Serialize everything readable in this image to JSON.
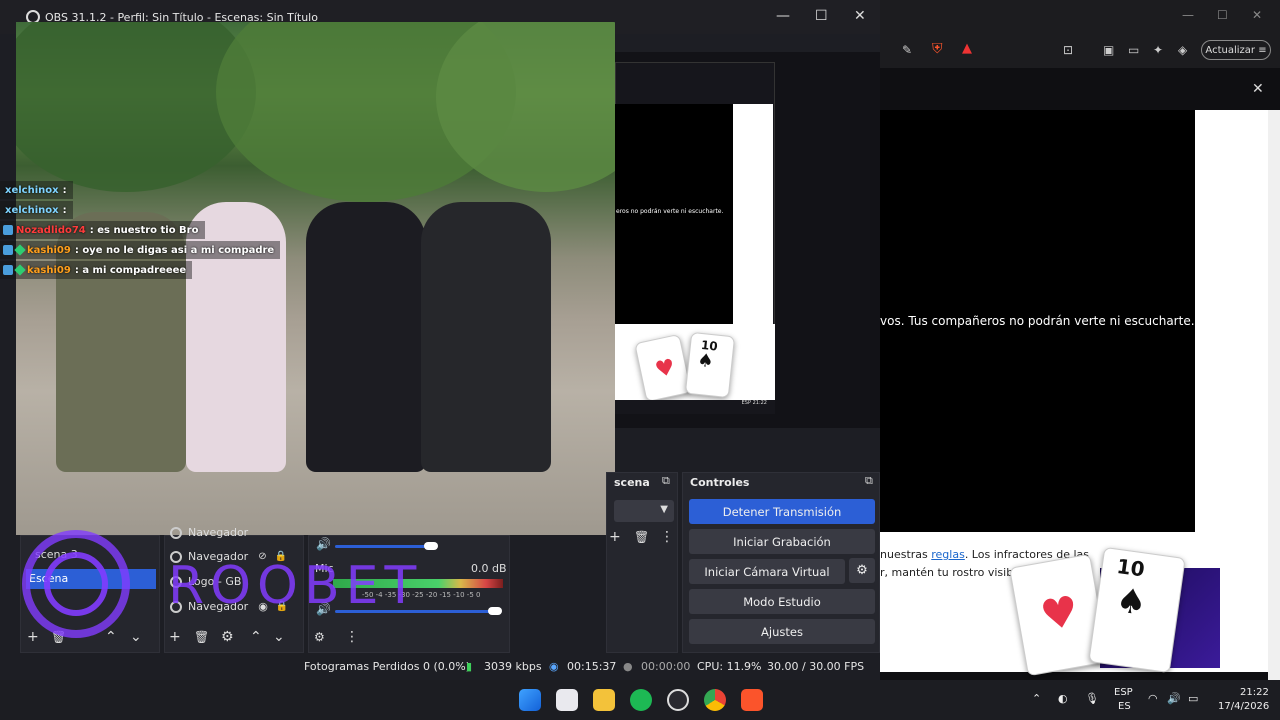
{
  "obs": {
    "window_title": "OBS 31.1.2 - Perfil: Sin Título - Escenas: Sin Título",
    "scenes_title": "scena",
    "scenes": [
      "scena 3",
      "Escena"
    ],
    "sources": [
      "Navegador",
      "Navegador",
      "Logo - GB",
      "Navegador"
    ],
    "mixer": {
      "mic_label": "Mic",
      "db_value": "0.0 dB",
      "meter_ticks": "-50 -4 -35 -30 -25 -20 -15 -10 -5 0"
    },
    "controls": {
      "title": "Controles",
      "stop_stream": "Detener Transmisión",
      "start_recording": "Iniciar Grabación",
      "start_virtual_cam": "Iniciar Cámara Virtual",
      "studio_mode": "Modo Estudio",
      "settings": "Ajustes"
    },
    "status": {
      "dropped_frames": "Fotogramas Perdidos 0 (0.0%)",
      "bitrate": "3039 kbps",
      "stream_time": "00:15:37",
      "rec_time": "00:00:00",
      "cpu": "CPU: 11.9%",
      "fps": "30.00 / 30.00 FPS"
    }
  },
  "chat": [
    {
      "user": "xelchinox",
      "message": "",
      "user_color": "#7fd3ff"
    },
    {
      "user": "xelchinox",
      "message": "",
      "user_color": "#7fd3ff"
    },
    {
      "user": "Nozadlido74",
      "message": "es nuestro tio Bro",
      "user_color": "#ff3b3b"
    },
    {
      "user": "kashi09",
      "message": "oye no le digas asi a mi compadre",
      "user_color": "#ff9f1c"
    },
    {
      "user": "kashi09",
      "message": "a mi compadreeee",
      "user_color": "#ff9f1c"
    }
  ],
  "mini_preview": {
    "modal_text": "eros no podrán verte ni escucharte.",
    "taskbar": "ESP 21:22"
  },
  "browser": {
    "update_label": "Actualizar",
    "modal_text": "vos. Tus compañeros no podrán verte ni escucharte.",
    "rules_prefix": "nuestras ",
    "rules_link": "reglas",
    "rules_suffix": ". Los infractores de las",
    "rules_line2": "r, mantén tu rostro visib"
  },
  "overlay": {
    "brand": "ROOBET",
    "card_number": "10"
  },
  "taskbar": {
    "lang": "ESP",
    "lang2": "ES",
    "time": "21:22",
    "date": "17/4/2026"
  },
  "colors": {
    "accent": "#2c5fd6",
    "brand_purple": "#823cff"
  }
}
